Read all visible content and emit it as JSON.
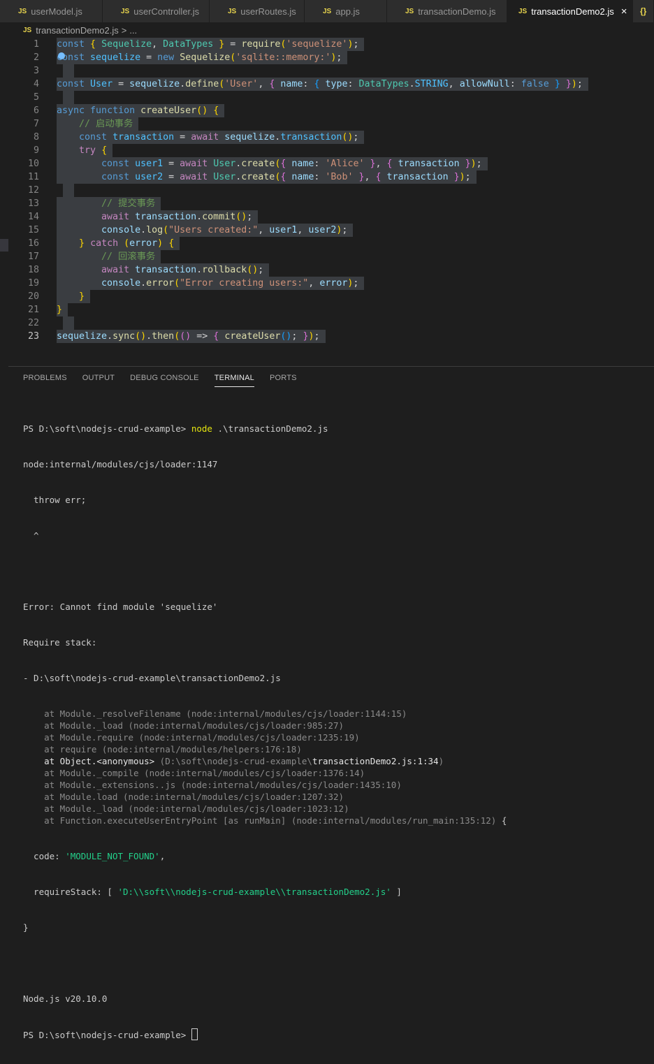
{
  "tabs": [
    {
      "label": "userModel.js",
      "active": false
    },
    {
      "label": "userController.js",
      "active": false
    },
    {
      "label": "userRoutes.js",
      "active": false
    },
    {
      "label": "app.js",
      "active": false
    },
    {
      "label": "transactionDemo.js",
      "active": false
    },
    {
      "label": "transactionDemo2.js",
      "active": true
    }
  ],
  "tab_js_badge": "JS",
  "overflow_icon": "{}",
  "close_glyph": "×",
  "breadcrumb": {
    "file": "transactionDemo2.js",
    "separator": ">",
    "rest": "..."
  },
  "editor": {
    "line_numbers": [
      "1",
      "2",
      "3",
      "4",
      "5",
      "6",
      "7",
      "8",
      "9",
      "10",
      "11",
      "12",
      "13",
      "14",
      "15",
      "16",
      "17",
      "18",
      "19",
      "20",
      "21",
      "22",
      "23"
    ],
    "current_line": "23",
    "lines": [
      "const { Sequelize, DataTypes } = require('sequelize');",
      "const sequelize = new Sequelize('sqlite::memory:');",
      "",
      "const User = sequelize.define('User', { name: { type: DataTypes.STRING, allowNull: false } });",
      "",
      "async function createUser() {",
      "    // 启动事务",
      "    const transaction = await sequelize.transaction();",
      "    try {",
      "        const user1 = await User.create({ name: 'Alice' }, { transaction });",
      "        const user2 = await User.create({ name: 'Bob' }, { transaction });",
      "",
      "        // 提交事务",
      "        await transaction.commit();",
      "        console.log(\"Users created:\", user1, user2);",
      "    } catch (error) {",
      "        // 回滚事务",
      "        await transaction.rollback();",
      "        console.error(\"Error creating users:\", error);",
      "    }",
      "}",
      "",
      "sequelize.sync().then(() => { createUser(); });"
    ]
  },
  "panel": {
    "tabs": [
      "PROBLEMS",
      "OUTPUT",
      "DEBUG CONSOLE",
      "TERMINAL",
      "PORTS"
    ],
    "active_tab": "TERMINAL"
  },
  "terminal": {
    "prompt": "PS D:\\soft\\nodejs-crud-example> ",
    "command_keyword": "node",
    "command_args": " .\\transactionDemo2.js",
    "lines": [
      "node:internal/modules/cjs/loader:1147",
      "  throw err;",
      "  ^",
      "",
      "Error: Cannot find module 'sequelize'",
      "Require stack:",
      "- D:\\soft\\nodejs-crud-example\\transactionDemo2.js"
    ],
    "stack": [
      {
        "at": "    at Module._resolveFilename",
        "loc": " (node:internal/modules/cjs/loader:1144:15)"
      },
      {
        "at": "    at Module._load",
        "loc": " (node:internal/modules/cjs/loader:985:27)"
      },
      {
        "at": "    at Module.require",
        "loc": " (node:internal/modules/cjs/loader:1235:19)"
      },
      {
        "at": "    at require",
        "loc": " (node:internal/modules/helpers:176:18)"
      },
      {
        "at": "    at Object.<anonymous>",
        "loc": " (D:\\soft\\nodejs-crud-example\\",
        "bold": "transactionDemo2.js:1:34",
        "end": ")"
      },
      {
        "at": "    at Module._compile",
        "loc": " (node:internal/modules/cjs/loader:1376:14)"
      },
      {
        "at": "    at Module._extensions..js",
        "loc": " (node:internal/modules/cjs/loader:1435:10)"
      },
      {
        "at": "    at Module.load",
        "loc": " (node:internal/modules/cjs/loader:1207:32)"
      },
      {
        "at": "    at Module._load",
        "loc": " (node:internal/modules/cjs/loader:1023:12)"
      },
      {
        "at": "    at Function.executeUserEntryPoint [as runMain]",
        "loc": " (node:internal/modules/run_main:135:12)",
        "tail": " {"
      }
    ],
    "code_key": "  code: ",
    "code_value": "'MODULE_NOT_FOUND'",
    "code_end": ",",
    "req_key": "  requireStack: [ ",
    "req_value": "'D:\\\\soft\\\\nodejs-crud-example\\\\transactionDemo2.js'",
    "req_end": " ]",
    "close_brace": "}",
    "node_version": "Node.js v20.10.0",
    "final_prompt": "PS D:\\soft\\nodejs-crud-example> "
  }
}
